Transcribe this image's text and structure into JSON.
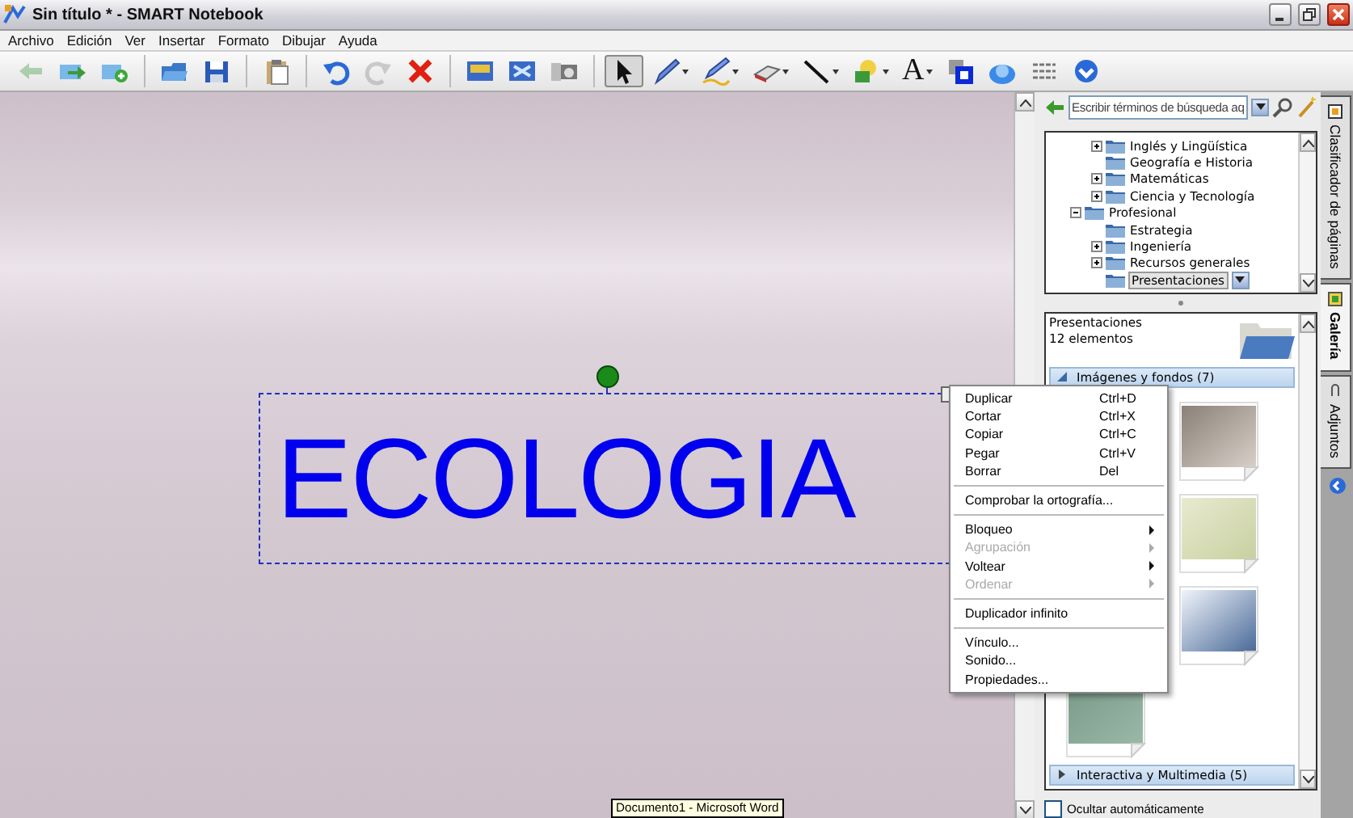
{
  "window": {
    "title": "Sin título * - SMART Notebook"
  },
  "menu": [
    "Archivo",
    "Edición",
    "Ver",
    "Insertar",
    "Formato",
    "Dibujar",
    "Ayuda"
  ],
  "toolbar": [
    {
      "kind": "previous-page",
      "disabled": true,
      "selected": false,
      "dropdown": false
    },
    {
      "kind": "next-page",
      "disabled": false,
      "selected": false,
      "dropdown": false
    },
    {
      "kind": "add-page",
      "disabled": false,
      "selected": false,
      "dropdown": false
    },
    {
      "kind": "separator"
    },
    {
      "kind": "open",
      "disabled": false,
      "selected": false,
      "dropdown": false
    },
    {
      "kind": "save",
      "disabled": false,
      "selected": false,
      "dropdown": false
    },
    {
      "kind": "separator"
    },
    {
      "kind": "paste",
      "disabled": false,
      "selected": false,
      "dropdown": false
    },
    {
      "kind": "separator"
    },
    {
      "kind": "undo",
      "disabled": false,
      "selected": false,
      "dropdown": false
    },
    {
      "kind": "redo",
      "disabled": true,
      "selected": false,
      "dropdown": false
    },
    {
      "kind": "delete",
      "disabled": false,
      "selected": false,
      "dropdown": false
    },
    {
      "kind": "separator"
    },
    {
      "kind": "screen-shade",
      "disabled": false,
      "selected": false,
      "dropdown": false
    },
    {
      "kind": "full-screen",
      "disabled": false,
      "selected": false,
      "dropdown": false
    },
    {
      "kind": "capture",
      "disabled": false,
      "selected": false,
      "dropdown": false
    },
    {
      "kind": "separator"
    },
    {
      "kind": "select",
      "disabled": false,
      "selected": true,
      "dropdown": false
    },
    {
      "kind": "pen",
      "disabled": false,
      "selected": false,
      "dropdown": true
    },
    {
      "kind": "creative-pen",
      "disabled": false,
      "selected": false,
      "dropdown": true
    },
    {
      "kind": "eraser",
      "disabled": false,
      "selected": false,
      "dropdown": true
    },
    {
      "kind": "line",
      "disabled": false,
      "selected": false,
      "dropdown": true
    },
    {
      "kind": "shapes",
      "disabled": false,
      "selected": false,
      "dropdown": true
    },
    {
      "kind": "text",
      "label": "A",
      "disabled": false,
      "selected": false,
      "dropdown": true
    },
    {
      "kind": "fill",
      "disabled": false,
      "selected": false,
      "dropdown": false
    },
    {
      "kind": "cloud",
      "disabled": false,
      "selected": false,
      "dropdown": false
    },
    {
      "kind": "lines",
      "disabled": false,
      "selected": false,
      "dropdown": false
    },
    {
      "kind": "more",
      "disabled": false,
      "selected": false,
      "dropdown": false
    }
  ],
  "canvas": {
    "text_object": {
      "text": "ECOLOGIA",
      "selected": true
    }
  },
  "context_menu": [
    {
      "kind": "item",
      "label": "Duplicar",
      "shortcut": "Ctrl+D",
      "disabled": false,
      "submenu": false
    },
    {
      "kind": "item",
      "label": "Cortar",
      "shortcut": "Ctrl+X",
      "disabled": false,
      "submenu": false
    },
    {
      "kind": "item",
      "label": "Copiar",
      "shortcut": "Ctrl+C",
      "disabled": false,
      "submenu": false
    },
    {
      "kind": "item",
      "label": "Pegar",
      "shortcut": "Ctrl+V",
      "disabled": false,
      "submenu": false
    },
    {
      "kind": "item",
      "label": "Borrar",
      "shortcut": "Del",
      "disabled": false,
      "submenu": false
    },
    {
      "kind": "separator"
    },
    {
      "kind": "item",
      "label": "Comprobar la ortografía...",
      "disabled": false,
      "submenu": false
    },
    {
      "kind": "separator"
    },
    {
      "kind": "item",
      "label": "Bloqueo",
      "disabled": false,
      "submenu": true
    },
    {
      "kind": "item",
      "label": "Agrupación",
      "disabled": true,
      "submenu": true
    },
    {
      "kind": "item",
      "label": "Voltear",
      "disabled": false,
      "submenu": true
    },
    {
      "kind": "item",
      "label": "Ordenar",
      "disabled": true,
      "submenu": true
    },
    {
      "kind": "separator"
    },
    {
      "kind": "item",
      "label": "Duplicador infinito",
      "disabled": false,
      "submenu": false
    },
    {
      "kind": "separator"
    },
    {
      "kind": "item",
      "label": "Vínculo...",
      "disabled": false,
      "submenu": false
    },
    {
      "kind": "item",
      "label": "Sonido...",
      "disabled": false,
      "submenu": false
    },
    {
      "kind": "item",
      "label": "Propiedades...",
      "disabled": false,
      "submenu": false
    }
  ],
  "taskbar_tooltip": "Documento1 - Microsoft Word",
  "sidebar": {
    "search": {
      "placeholder": "Escribir términos de búsqueda aq"
    },
    "tree": [
      {
        "children": [
          {
            "label": "Inglés y Lingüística",
            "expanded": false,
            "selected": false
          },
          {
            "label": "Geografía e Historia",
            "selected": false
          },
          {
            "label": "Matemáticas",
            "expanded": false,
            "selected": false
          },
          {
            "label": "Ciencia y Tecnología",
            "expanded": false,
            "selected": false
          }
        ]
      },
      {
        "label": "Profesional",
        "expanded": true,
        "selected": false,
        "children": [
          {
            "label": "Estrategia",
            "selected": false
          },
          {
            "label": "Ingeniería",
            "expanded": false,
            "selected": false
          },
          {
            "label": "Recursos generales",
            "expanded": false,
            "selected": false
          },
          {
            "label": "Presentaciones",
            "selected": true
          }
        ]
      }
    ],
    "gallery": {
      "title": "Presentaciones",
      "count": "12 elementos",
      "categories": [
        {
          "label": "Imágenes y fondos (7)",
          "expanded": true
        },
        {
          "label": "Interactiva y Multimedia (5)",
          "expanded": false
        }
      ]
    },
    "auto_hide": {
      "label": "Ocultar automáticamente",
      "checked": false
    }
  },
  "side_tabs": [
    {
      "kind": "page-sorter",
      "label": "Clasificador de páginas",
      "selected": false
    },
    {
      "kind": "gallery",
      "label": "Galería",
      "selected": true
    },
    {
      "kind": "attachments",
      "label": "Adjuntos",
      "selected": false
    }
  ]
}
